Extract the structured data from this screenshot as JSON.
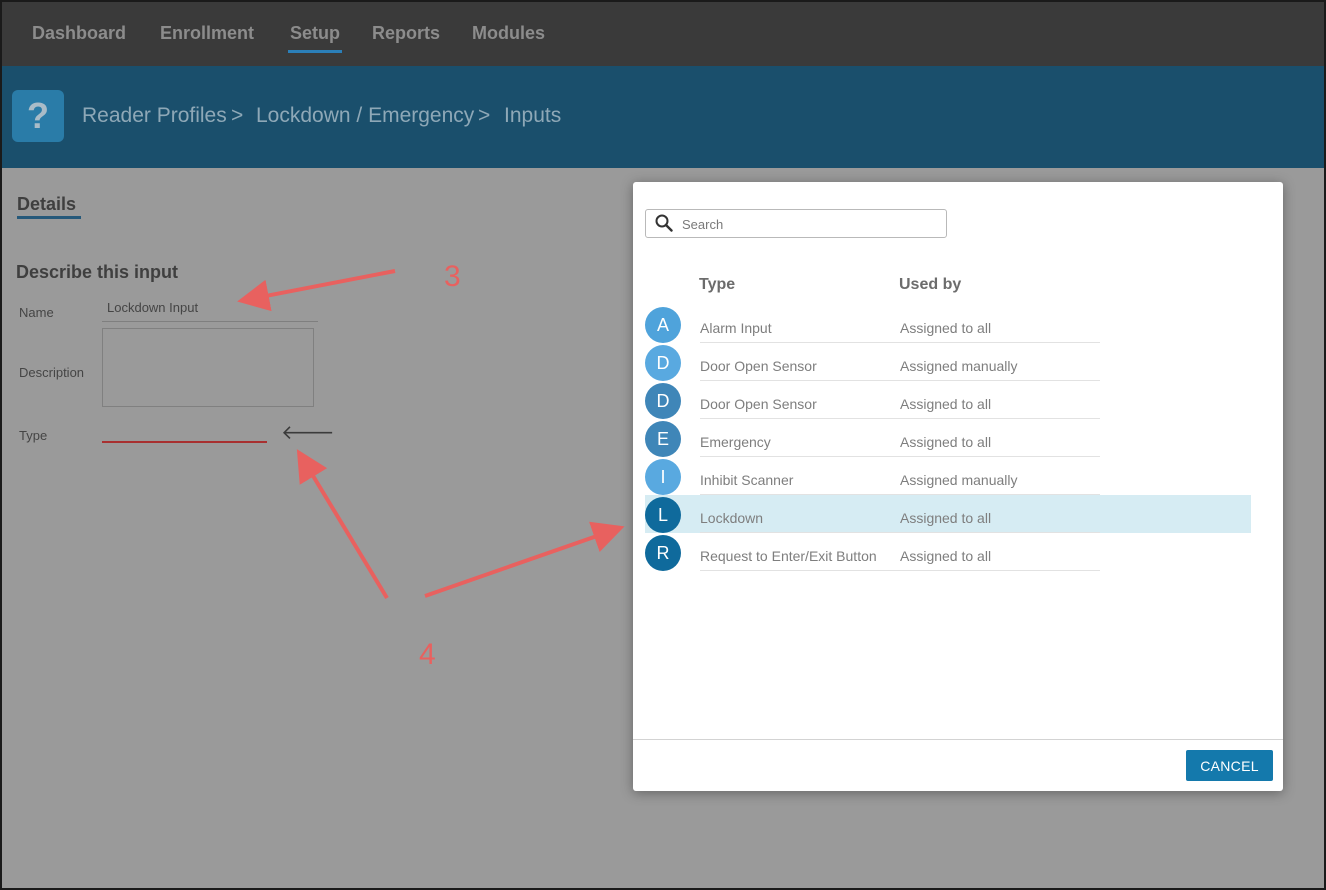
{
  "nav": {
    "items": [
      "Dashboard",
      "Enrollment",
      "Setup",
      "Reports",
      "Modules"
    ],
    "active": "Setup"
  },
  "header": {
    "help_icon": "?",
    "breadcrumb": [
      "Reader Profiles",
      ">",
      "Lockdown / Emergency",
      ">",
      "Inputs"
    ]
  },
  "content": {
    "tab": "Details",
    "section_title": "Describe this input",
    "fields": {
      "name_label": "Name",
      "name_value": "Lockdown Input",
      "description_label": "Description",
      "type_label": "Type"
    }
  },
  "modal": {
    "search_placeholder": "Search",
    "columns": {
      "type": "Type",
      "used_by": "Used by"
    },
    "rows": [
      {
        "initial": "A",
        "type": "Alarm Input",
        "used_by": "Assigned to all",
        "color": "#4fa3db",
        "selected": false
      },
      {
        "initial": "D",
        "type": "Door Open Sensor",
        "used_by": "Assigned manually",
        "color": "#59a9e0",
        "selected": false
      },
      {
        "initial": "D",
        "type": "Door Open Sensor",
        "used_by": "Assigned to all",
        "color": "#3f86b8",
        "selected": false
      },
      {
        "initial": "E",
        "type": "Emergency",
        "used_by": "Assigned to all",
        "color": "#3f86b8",
        "selected": false
      },
      {
        "initial": "I",
        "type": "Inhibit Scanner",
        "used_by": "Assigned manually",
        "color": "#59a9e0",
        "selected": false
      },
      {
        "initial": "L",
        "type": "Lockdown",
        "used_by": "Assigned to all",
        "color": "#0f6a9c",
        "selected": true
      },
      {
        "initial": "R",
        "type": "Request to Enter/Exit Button",
        "used_by": "Assigned to all",
        "color": "#0f6a9c",
        "selected": false
      }
    ],
    "cancel_label": "CANCEL"
  },
  "annotations": {
    "label_3": "3",
    "label_4": "4",
    "color": "#e8615f"
  },
  "icons": {
    "search": "search-icon",
    "arrow": "arrow-left-icon",
    "help": "question-icon"
  }
}
